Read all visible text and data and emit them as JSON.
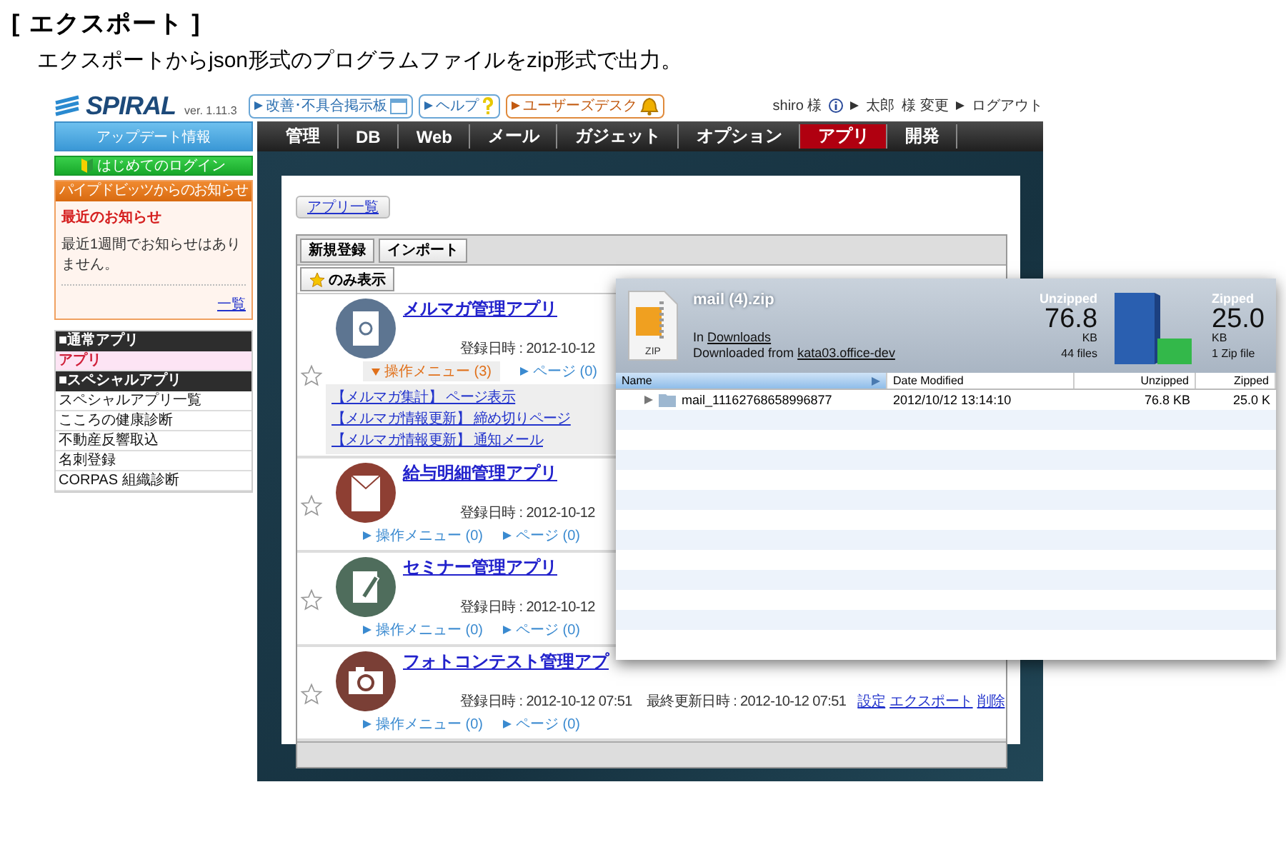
{
  "page": {
    "title": "[ エクスポート ]",
    "subtitle": "エクスポートからjson形式のプログラムファイルをzip形式で出力。"
  },
  "header": {
    "logo": "SPIRAL",
    "version": "ver. 1.11.3",
    "buttons": [
      {
        "label": "改善･不具合掲示板",
        "kind": "board"
      },
      {
        "label": "ヘルプ",
        "kind": "help"
      },
      {
        "label": "ユーザーズデスク",
        "kind": "desk"
      }
    ]
  },
  "account": {
    "user": "shiro 様",
    "name": "太郎",
    "name_suffix": "様 変更",
    "logout": "ログアウト"
  },
  "nav": [
    {
      "label": "管理",
      "selected": false
    },
    {
      "label": "DB",
      "selected": false
    },
    {
      "label": "Web",
      "selected": false
    },
    {
      "label": "メール",
      "selected": false
    },
    {
      "label": "ガジェット",
      "selected": false
    },
    {
      "label": "オプション",
      "selected": false
    },
    {
      "label": "アプリ",
      "selected": true
    },
    {
      "label": "開発",
      "selected": false
    }
  ],
  "sidebar": {
    "update_button": "アップデート情報",
    "login_button": "はじめてのログイン",
    "notice": {
      "title": "パイプドビッツからのお知らせ",
      "heading": "最近のお知らせ",
      "body": "最近1週間でお知らせはありません。",
      "more": "一覧"
    },
    "menu": [
      {
        "label": "■通常アプリ",
        "kind": "header"
      },
      {
        "label": "アプリ",
        "kind": "item",
        "selected": true
      },
      {
        "label": "■スペシャルアプリ",
        "kind": "header"
      },
      {
        "label": "スペシャルアプリ一覧",
        "kind": "item",
        "selected": false
      },
      {
        "label": "こころの健康診断",
        "kind": "item",
        "selected": false
      },
      {
        "label": "不動産反響取込",
        "kind": "item",
        "selected": false
      },
      {
        "label": "名刺登録",
        "kind": "item",
        "selected": false
      },
      {
        "label": "CORPAS 組織診断",
        "kind": "item",
        "selected": false
      }
    ]
  },
  "content": {
    "list_button": "アプリ一覧",
    "toolbar": [
      "新規登録",
      "インポート"
    ],
    "filter_button": "のみ表示",
    "apps": [
      {
        "name": "メルマガ管理アプリ",
        "kind": "document",
        "color": "#5d7591",
        "starred": false,
        "registered": "登録日時 : 2012-10-12",
        "menu": "操作メニュー (3)",
        "menu_expanded": true,
        "page": "ページ (0)",
        "submenu": [
          "【メルマガ集計】 ページ表示",
          "【メルマガ情報更新】 締め切りページ",
          "【メルマガ情報更新】 通知メール"
        ]
      },
      {
        "name": "給与明細管理アプリ",
        "kind": "envelope",
        "color": "#8e3f33",
        "starred": false,
        "registered": "登録日時 : 2012-10-12",
        "menu": "操作メニュー (0)",
        "menu_expanded": false,
        "page": "ページ (0)"
      },
      {
        "name": "セミナー管理アプリ",
        "kind": "note",
        "color": "#4f6d5c",
        "starred": false,
        "registered": "登録日時 : 2012-10-12",
        "menu": "操作メニュー (0)",
        "menu_expanded": false,
        "page": "ページ (0)"
      },
      {
        "name": "フォトコンテスト管理アプ",
        "kind": "camera",
        "color": "#7a3f36",
        "starred": false,
        "registered": "登録日時 : 2012-10-12 07:51",
        "updated": "最終更新日時 : 2012-10-12 07:51",
        "menu": "操作メニュー (0)",
        "menu_expanded": false,
        "page": "ページ (0)",
        "links": [
          "設定",
          "エクスポート",
          "削除"
        ]
      }
    ]
  },
  "archive": {
    "file_name": "mail (4).zip",
    "file_label": "ZIP",
    "location_prefix": "In",
    "location": "Downloads",
    "source_prefix": "Downloaded from",
    "source": "kata03.office-dev",
    "unzipped": {
      "label": "Unzipped",
      "value": "76.8",
      "unit": "KB",
      "note": "44 files"
    },
    "zipped": {
      "label": "Zipped",
      "value": "25.0",
      "unit": "KB",
      "note": "1 Zip file"
    },
    "columns": [
      {
        "label": "Name",
        "selected": true
      },
      {
        "label": "Date Modified",
        "selected": false
      },
      {
        "label": "Unzipped",
        "selected": false
      },
      {
        "label": "Zipped",
        "selected": false
      }
    ],
    "rows": [
      {
        "name": "mail_11162768658996877",
        "date": "2012/10/12 13:14:10",
        "unzipped": "76.8 KB",
        "zipped": "25.0 K",
        "expanded": false
      }
    ]
  }
}
